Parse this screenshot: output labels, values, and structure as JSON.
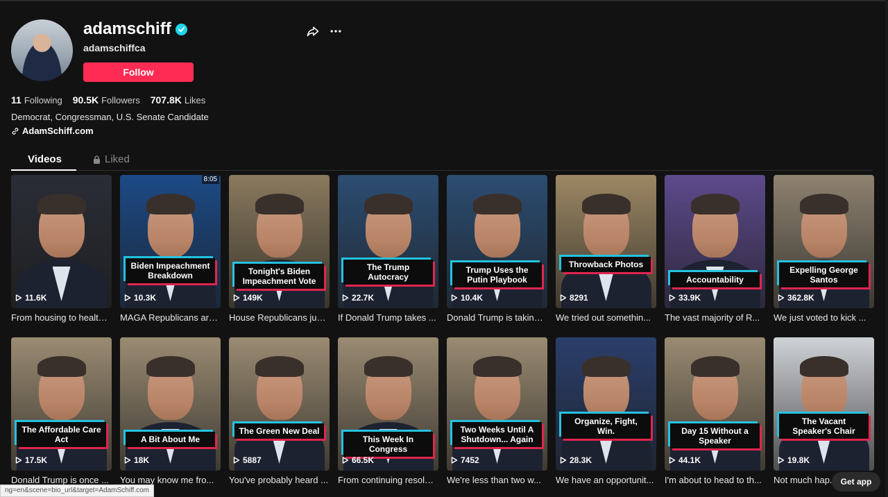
{
  "profile": {
    "username": "adamschiff",
    "nickname": "adamschiffca",
    "follow_label": "Follow",
    "stats": {
      "following_count": "11",
      "following_label": "Following",
      "followers_count": "90.5K",
      "followers_label": "Followers",
      "likes_count": "707.8K",
      "likes_label": "Likes"
    },
    "bio": "Democrat, Congressman, U.S. Senate Candidate",
    "link": "AdamSchiff.com"
  },
  "tabs": {
    "videos": "Videos",
    "liked": "Liked"
  },
  "colors": {
    "accent": "#fe2c55",
    "verified": "#20d5ec",
    "background": "#121212"
  },
  "videos": [
    {
      "views": "11.6K",
      "desc": "From housing to health...",
      "caption": "",
      "duration": "",
      "bg": "#2a2d36"
    },
    {
      "views": "10.3K",
      "desc": "MAGA Republicans are...",
      "caption": "Biden Impeachment Breakdown",
      "duration": "8:05",
      "bg": "#1c4a86"
    },
    {
      "views": "149K",
      "desc": "House Republicans jus...",
      "caption": "Tonight's Biden Impeachment Vote",
      "duration": "",
      "bg": "#8a7a5e"
    },
    {
      "views": "22.7K",
      "desc": "If Donald Trump takes ...",
      "caption": "The Trump Autocracy",
      "duration": "",
      "bg": "#2c4d72"
    },
    {
      "views": "10.4K",
      "desc": "Donald Trump is taking...",
      "caption": "Trump Uses the Putin Playbook",
      "duration": "",
      "bg": "#2c4d72"
    },
    {
      "views": "8291",
      "desc": "We tried out somethin...",
      "caption": "Throwback Photos",
      "duration": "",
      "bg": "#9c8864"
    },
    {
      "views": "33.9K",
      "desc": "The vast majority of R...",
      "caption": "Accountability",
      "duration": "",
      "bg": "#5d4a8c"
    },
    {
      "views": "362.8K",
      "desc": "We just voted to kick ...",
      "caption": "Expelling George Santos",
      "duration": "",
      "bg": "#8e8270"
    },
    {
      "views": "17.5K",
      "desc": "Donald Trump is once ...",
      "caption": "The Affordable Care Act",
      "duration": "",
      "bg": "#9a8b72"
    },
    {
      "views": "18K",
      "desc": "You may know me fro...",
      "caption": "A Bit About Me",
      "duration": "",
      "bg": "#9a8b72"
    },
    {
      "views": "5887",
      "desc": "You've probably heard ...",
      "caption": "The Green New Deal",
      "duration": "",
      "bg": "#9a8b72"
    },
    {
      "views": "66.5K",
      "desc": "From continuing resolu...",
      "caption": "This Week In Congress",
      "duration": "",
      "bg": "#9a8b72"
    },
    {
      "views": "7452",
      "desc": "We're less than two w...",
      "caption": "Two Weeks Until A Shutdown... Again",
      "duration": "",
      "bg": "#9a8b72"
    },
    {
      "views": "28.3K",
      "desc": "We have an opportunit...",
      "caption": "Organize, Fight, Win.",
      "duration": "",
      "bg": "#2b3f6b"
    },
    {
      "views": "44.1K",
      "desc": "I'm about to head to th...",
      "caption": "Day 15 Without a Speaker",
      "duration": "",
      "bg": "#9a8b72"
    },
    {
      "views": "19.8K",
      "desc": "Not much hap...",
      "caption": "The Vacant Speaker's Chair",
      "duration": "",
      "bg": "#cfd2d6"
    }
  ],
  "status_url": "ng=en&scene=bio_url&target=AdamSchiff.com",
  "get_app_label": "Get app"
}
